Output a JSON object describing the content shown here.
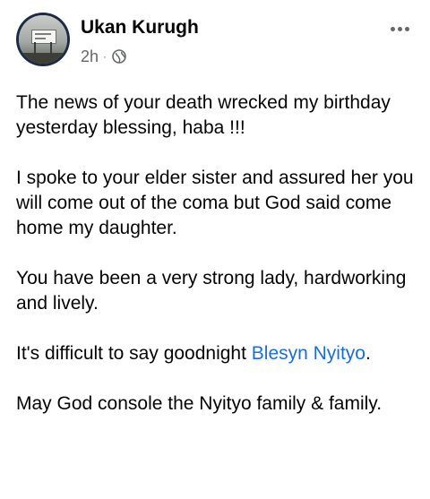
{
  "author": {
    "name": "Ukan Kurugh",
    "time": "2h",
    "separator": "·",
    "privacy_icon": "globe-icon"
  },
  "menu": {
    "icon": "more-options-icon"
  },
  "post": {
    "p1": "The news of your death wrecked my birthday yesterday blessing, haba !!!",
    "p2": "I spoke to your elder sister and assured her you will come out of the coma but God said come home my daughter.",
    "p3": "You have been a very strong lady, hardworking and lively.",
    "p4_prefix": "It's difficult to say goodnight ",
    "p4_mention": "Blesyn Nyityo",
    "p4_suffix": ".",
    "p5": "May God console the Nyityo family & family."
  },
  "colors": {
    "text": "#050505",
    "secondary": "#65676b",
    "mention": "#1a6ed8"
  }
}
